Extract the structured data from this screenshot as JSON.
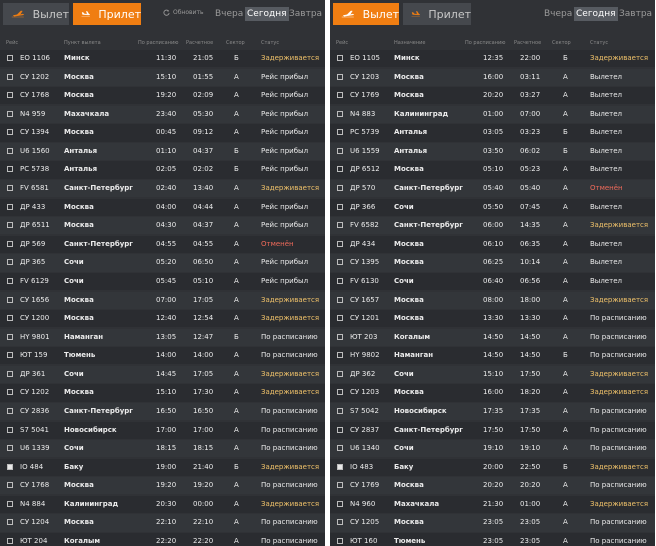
{
  "colors": {
    "accent": "#f07e12",
    "panel_bg": "#303236",
    "late": "#f0c26a",
    "cancelled": "#ee6a5a"
  },
  "left": {
    "tabs": [
      {
        "label": "Вылет",
        "icon": "departure-plane-icon",
        "active": false
      },
      {
        "label": "Прилет",
        "icon": "arrival-plane-icon",
        "active": true
      }
    ],
    "refresh_label": "Обновить",
    "days": [
      {
        "label": "Вчера",
        "selected": false
      },
      {
        "label": "Сегодня",
        "selected": true
      },
      {
        "label": "Завтра",
        "selected": false
      }
    ],
    "headers": [
      "Рейс",
      "Пункт вылета",
      "По расписанию",
      "Расчетное",
      "Сектор",
      "Статус"
    ],
    "rows": [
      {
        "flight": "ЕО 1106",
        "city": "Минск",
        "t1": "11:30",
        "t2": "21:05",
        "sector": "Б",
        "status": "Задерживается",
        "kind": "late",
        "checked": false
      },
      {
        "flight": "СУ 1202",
        "city": "Москва",
        "t1": "15:10",
        "t2": "01:55",
        "sector": "А",
        "status": "Рейс прибыл",
        "kind": "norm",
        "checked": false
      },
      {
        "flight": "СУ 1768",
        "city": "Москва",
        "t1": "19:20",
        "t2": "02:09",
        "sector": "А",
        "status": "Рейс прибыл",
        "kind": "norm",
        "checked": false
      },
      {
        "flight": "N4 959",
        "city": "Махачкала",
        "t1": "23:40",
        "t2": "05:30",
        "sector": "А",
        "status": "Рейс прибыл",
        "kind": "norm",
        "checked": false
      },
      {
        "flight": "СУ 1394",
        "city": "Москва",
        "t1": "00:45",
        "t2": "09:12",
        "sector": "А",
        "status": "Рейс прибыл",
        "kind": "norm",
        "checked": false
      },
      {
        "flight": "U6 1560",
        "city": "Анталья",
        "t1": "01:10",
        "t2": "04:37",
        "sector": "Б",
        "status": "Рейс прибыл",
        "kind": "norm",
        "checked": false
      },
      {
        "flight": "PC 5738",
        "city": "Анталья",
        "t1": "02:05",
        "t2": "02:02",
        "sector": "Б",
        "status": "Рейс прибыл",
        "kind": "norm",
        "checked": false
      },
      {
        "flight": "FV 6581",
        "city": "Санкт-Петербург",
        "t1": "02:40",
        "t2": "13:40",
        "sector": "А",
        "status": "Задерживается",
        "kind": "late",
        "checked": false
      },
      {
        "flight": "ДР 433",
        "city": "Москва",
        "t1": "04:00",
        "t2": "04:44",
        "sector": "А",
        "status": "Рейс прибыл",
        "kind": "norm",
        "checked": false
      },
      {
        "flight": "ДР 6511",
        "city": "Москва",
        "t1": "04:30",
        "t2": "04:37",
        "sector": "А",
        "status": "Рейс прибыл",
        "kind": "norm",
        "checked": false
      },
      {
        "flight": "ДР 569",
        "city": "Санкт-Петербург",
        "t1": "04:55",
        "t2": "04:55",
        "sector": "А",
        "status": "Отменён",
        "kind": "cancel",
        "checked": false
      },
      {
        "flight": "ДР 365",
        "city": "Сочи",
        "t1": "05:20",
        "t2": "06:50",
        "sector": "А",
        "status": "Рейс прибыл",
        "kind": "norm",
        "checked": false
      },
      {
        "flight": "FV 6129",
        "city": "Сочи",
        "t1": "05:45",
        "t2": "05:10",
        "sector": "А",
        "status": "Рейс прибыл",
        "kind": "norm",
        "checked": false
      },
      {
        "flight": "СУ 1656",
        "city": "Москва",
        "t1": "07:00",
        "t2": "17:05",
        "sector": "А",
        "status": "Задерживается",
        "kind": "late",
        "checked": false
      },
      {
        "flight": "СУ 1200",
        "city": "Москва",
        "t1": "12:40",
        "t2": "12:54",
        "sector": "А",
        "status": "Задерживается",
        "kind": "late",
        "checked": false
      },
      {
        "flight": "HY 9801",
        "city": "Наманган",
        "t1": "13:05",
        "t2": "12:47",
        "sector": "Б",
        "status": "По расписанию",
        "kind": "norm",
        "checked": false
      },
      {
        "flight": "ЮТ 159",
        "city": "Тюмень",
        "t1": "14:00",
        "t2": "14:00",
        "sector": "А",
        "status": "По расписанию",
        "kind": "norm",
        "checked": false
      },
      {
        "flight": "ДР 361",
        "city": "Сочи",
        "t1": "14:45",
        "t2": "17:05",
        "sector": "А",
        "status": "Задерживается",
        "kind": "late",
        "checked": false
      },
      {
        "flight": "СУ 1202",
        "city": "Москва",
        "t1": "15:10",
        "t2": "17:30",
        "sector": "А",
        "status": "Задерживается",
        "kind": "late",
        "checked": false
      },
      {
        "flight": "СУ 2836",
        "city": "Санкт-Петербург",
        "t1": "16:50",
        "t2": "16:50",
        "sector": "А",
        "status": "По расписанию",
        "kind": "norm",
        "checked": false
      },
      {
        "flight": "S7 5041",
        "city": "Новосибирск",
        "t1": "17:00",
        "t2": "17:00",
        "sector": "А",
        "status": "По расписанию",
        "kind": "norm",
        "checked": false
      },
      {
        "flight": "U6 1339",
        "city": "Сочи",
        "t1": "18:15",
        "t2": "18:15",
        "sector": "А",
        "status": "По расписанию",
        "kind": "norm",
        "checked": false
      },
      {
        "flight": "IO 484",
        "city": "Баку",
        "t1": "19:00",
        "t2": "21:40",
        "sector": "Б",
        "status": "Задерживается",
        "kind": "late",
        "checked": true
      },
      {
        "flight": "СУ 1768",
        "city": "Москва",
        "t1": "19:20",
        "t2": "19:20",
        "sector": "А",
        "status": "По расписанию",
        "kind": "norm",
        "checked": false
      },
      {
        "flight": "N4 884",
        "city": "Калининград",
        "t1": "20:30",
        "t2": "00:00",
        "sector": "А",
        "status": "Задерживается",
        "kind": "late",
        "checked": false
      },
      {
        "flight": "СУ 1204",
        "city": "Москва",
        "t1": "22:10",
        "t2": "22:10",
        "sector": "А",
        "status": "По расписанию",
        "kind": "norm",
        "checked": false
      },
      {
        "flight": "ЮТ 204",
        "city": "Когалым",
        "t1": "22:20",
        "t2": "22:20",
        "sector": "А",
        "status": "По расписанию",
        "kind": "norm",
        "checked": false
      }
    ]
  },
  "right": {
    "tabs": [
      {
        "label": "Вылет",
        "icon": "departure-plane-icon",
        "active": true
      },
      {
        "label": "Прилет",
        "icon": "arrival-plane-icon",
        "active": false
      }
    ],
    "days": [
      {
        "label": "Вчера",
        "selected": false
      },
      {
        "label": "Сегодня",
        "selected": true
      },
      {
        "label": "Завтра",
        "selected": false
      }
    ],
    "headers": [
      "Рейс",
      "Назначение",
      "По расписанию",
      "Расчетное",
      "Сектор",
      "Статус"
    ],
    "rows": [
      {
        "flight": "ЕО 1105",
        "city": "Минск",
        "t1": "12:35",
        "t2": "22:00",
        "sector": "Б",
        "status": "Задерживается",
        "kind": "late",
        "checked": false
      },
      {
        "flight": "СУ 1203",
        "city": "Москва",
        "t1": "16:00",
        "t2": "03:11",
        "sector": "А",
        "status": "Вылетел",
        "kind": "norm",
        "checked": false
      },
      {
        "flight": "СУ 1769",
        "city": "Москва",
        "t1": "20:20",
        "t2": "03:27",
        "sector": "А",
        "status": "Вылетел",
        "kind": "norm",
        "checked": false
      },
      {
        "flight": "N4 883",
        "city": "Калининград",
        "t1": "01:00",
        "t2": "07:00",
        "sector": "А",
        "status": "Вылетел",
        "kind": "norm",
        "checked": false
      },
      {
        "flight": "PC 5739",
        "city": "Анталья",
        "t1": "03:05",
        "t2": "03:23",
        "sector": "Б",
        "status": "Вылетел",
        "kind": "norm",
        "checked": false
      },
      {
        "flight": "U6 1559",
        "city": "Анталья",
        "t1": "03:50",
        "t2": "06:02",
        "sector": "Б",
        "status": "Вылетел",
        "kind": "norm",
        "checked": false
      },
      {
        "flight": "ДР 6512",
        "city": "Москва",
        "t1": "05:10",
        "t2": "05:23",
        "sector": "А",
        "status": "Вылетел",
        "kind": "norm",
        "checked": false
      },
      {
        "flight": "ДР 570",
        "city": "Санкт-Петербург",
        "t1": "05:40",
        "t2": "05:40",
        "sector": "А",
        "status": "Отменён",
        "kind": "cancel",
        "checked": false
      },
      {
        "flight": "ДР 366",
        "city": "Сочи",
        "t1": "05:50",
        "t2": "07:45",
        "sector": "А",
        "status": "Вылетел",
        "kind": "norm",
        "checked": false
      },
      {
        "flight": "FV 6582",
        "city": "Санкт-Петербург",
        "t1": "06:00",
        "t2": "14:35",
        "sector": "А",
        "status": "Задерживается",
        "kind": "late",
        "checked": false
      },
      {
        "flight": "ДР 434",
        "city": "Москва",
        "t1": "06:10",
        "t2": "06:35",
        "sector": "А",
        "status": "Вылетел",
        "kind": "norm",
        "checked": false
      },
      {
        "flight": "СУ 1395",
        "city": "Москва",
        "t1": "06:25",
        "t2": "10:14",
        "sector": "А",
        "status": "Вылетел",
        "kind": "norm",
        "checked": false
      },
      {
        "flight": "FV 6130",
        "city": "Сочи",
        "t1": "06:40",
        "t2": "06:56",
        "sector": "А",
        "status": "Вылетел",
        "kind": "norm",
        "checked": false
      },
      {
        "flight": "СУ 1657",
        "city": "Москва",
        "t1": "08:00",
        "t2": "18:00",
        "sector": "А",
        "status": "Задерживается",
        "kind": "late",
        "checked": false
      },
      {
        "flight": "СУ 1201",
        "city": "Москва",
        "t1": "13:30",
        "t2": "13:30",
        "sector": "А",
        "status": "По расписанию",
        "kind": "norm",
        "checked": false
      },
      {
        "flight": "ЮТ 203",
        "city": "Когалым",
        "t1": "14:50",
        "t2": "14:50",
        "sector": "А",
        "status": "По расписанию",
        "kind": "norm",
        "checked": false
      },
      {
        "flight": "HY 9802",
        "city": "Наманган",
        "t1": "14:50",
        "t2": "14:50",
        "sector": "Б",
        "status": "По расписанию",
        "kind": "norm",
        "checked": false
      },
      {
        "flight": "ДР 362",
        "city": "Сочи",
        "t1": "15:10",
        "t2": "17:50",
        "sector": "А",
        "status": "Задерживается",
        "kind": "late",
        "checked": false
      },
      {
        "flight": "СУ 1203",
        "city": "Москва",
        "t1": "16:00",
        "t2": "18:20",
        "sector": "А",
        "status": "Задерживается",
        "kind": "late",
        "checked": false
      },
      {
        "flight": "S7 5042",
        "city": "Новосибирск",
        "t1": "17:35",
        "t2": "17:35",
        "sector": "А",
        "status": "По расписанию",
        "kind": "norm",
        "checked": false
      },
      {
        "flight": "СУ 2837",
        "city": "Санкт-Петербург",
        "t1": "17:50",
        "t2": "17:50",
        "sector": "А",
        "status": "По расписанию",
        "kind": "norm",
        "checked": false
      },
      {
        "flight": "U6 1340",
        "city": "Сочи",
        "t1": "19:10",
        "t2": "19:10",
        "sector": "А",
        "status": "По расписанию",
        "kind": "norm",
        "checked": false
      },
      {
        "flight": "IO 483",
        "city": "Баку",
        "t1": "20:00",
        "t2": "22:50",
        "sector": "Б",
        "status": "Задерживается",
        "kind": "late",
        "checked": true
      },
      {
        "flight": "СУ 1769",
        "city": "Москва",
        "t1": "20:20",
        "t2": "20:20",
        "sector": "А",
        "status": "По расписанию",
        "kind": "norm",
        "checked": false
      },
      {
        "flight": "N4 960",
        "city": "Махачкала",
        "t1": "21:30",
        "t2": "01:00",
        "sector": "А",
        "status": "Задерживается",
        "kind": "late",
        "checked": false
      },
      {
        "flight": "СУ 1205",
        "city": "Москва",
        "t1": "23:05",
        "t2": "23:05",
        "sector": "А",
        "status": "По расписанию",
        "kind": "norm",
        "checked": false
      },
      {
        "flight": "ЮТ 160",
        "city": "Тюмень",
        "t1": "23:05",
        "t2": "23:05",
        "sector": "А",
        "status": "По расписанию",
        "kind": "norm",
        "checked": false
      }
    ]
  }
}
